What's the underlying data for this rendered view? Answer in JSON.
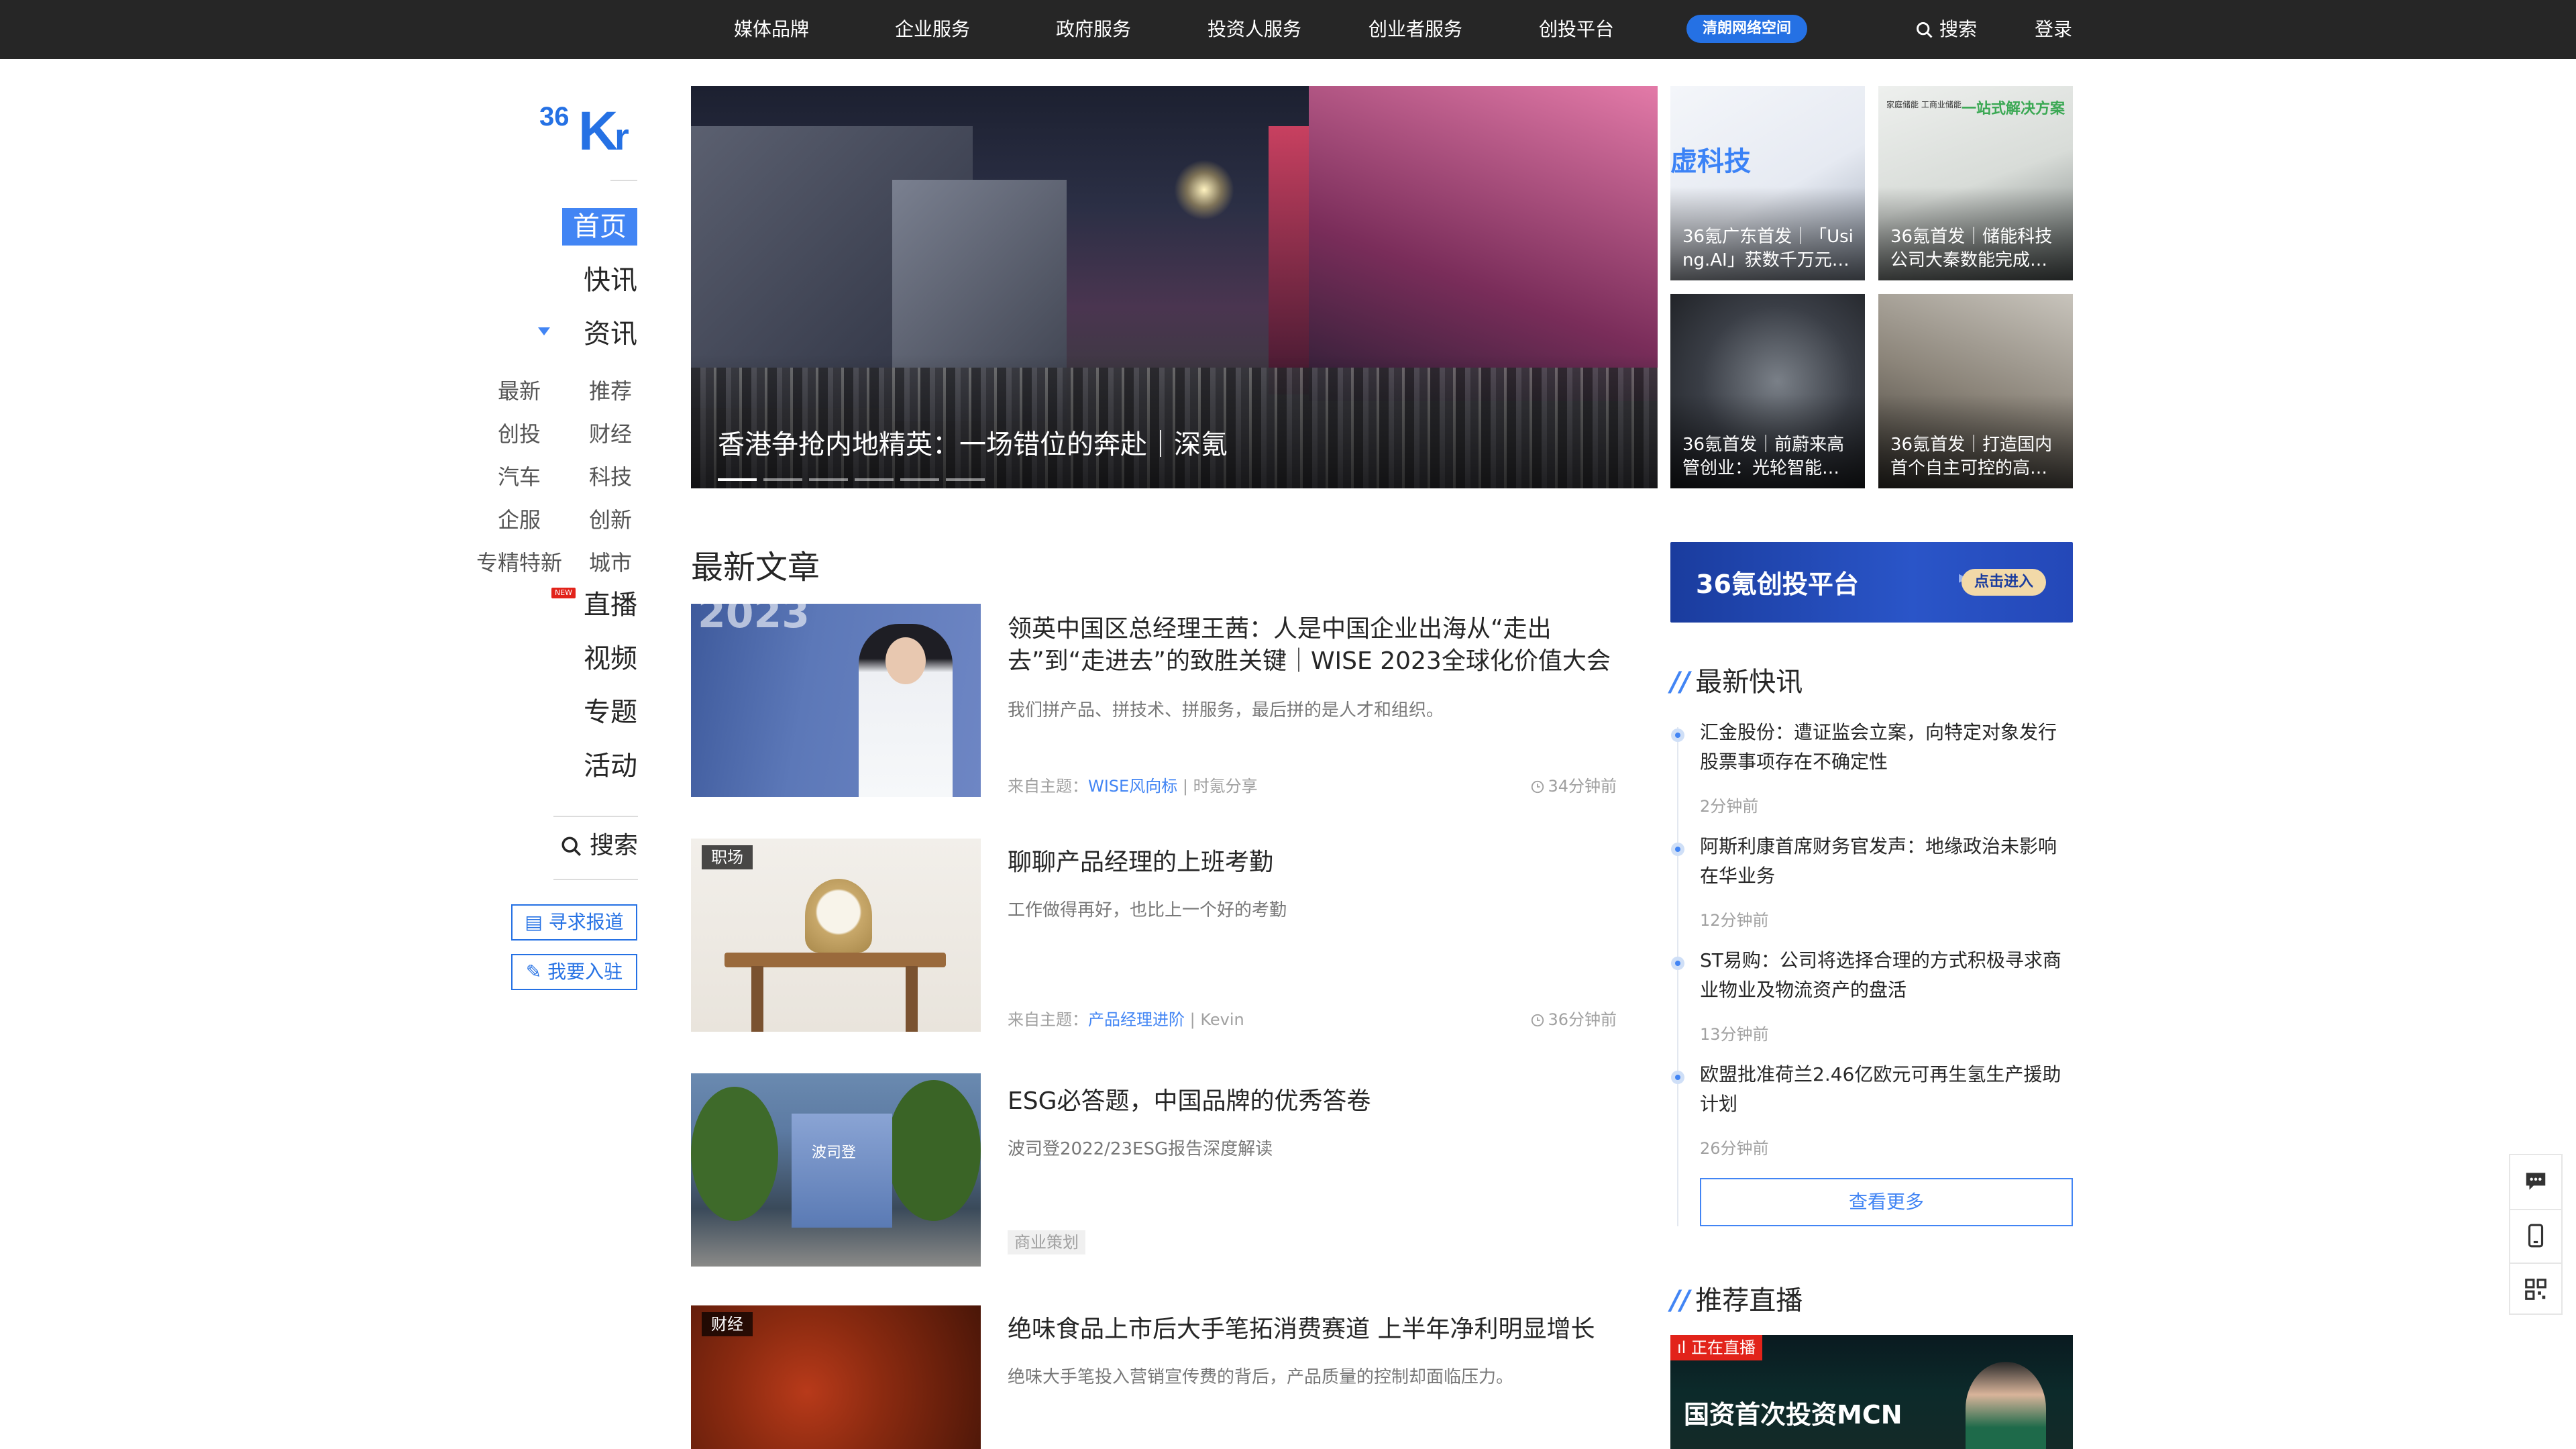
{
  "topnav": {
    "items": [
      "媒体品牌",
      "企业服务",
      "政府服务",
      "投资人服务",
      "创业者服务",
      "创投平台"
    ],
    "badge": "清朗网络空间",
    "search_label": "搜索",
    "login_label": "登录"
  },
  "logo": "36Kr",
  "sidebar": {
    "main": [
      "首页",
      "快讯",
      "资讯",
      "直播",
      "视频",
      "专题",
      "活动"
    ],
    "sub": [
      [
        "最新",
        "推荐"
      ],
      [
        "创投",
        "财经"
      ],
      [
        "汽车",
        "科技"
      ],
      [
        "企服",
        "创新"
      ],
      [
        "专精特新",
        "城市"
      ]
    ],
    "new_tag": "NEW",
    "search_label": "搜索",
    "report_btn": "寻求报道",
    "join_btn": "我要入驻"
  },
  "hero": {
    "title": "香港争抢内地精英：一场错位的奔赴｜深氪",
    "dots": 6,
    "active_dot": 0
  },
  "thumbs": [
    {
      "line1": "36氪广东首发｜「Usi",
      "line2": "ng.AI」获数千万元…",
      "text": "虚科技"
    },
    {
      "line1": "36氪首发｜储能科技",
      "line2": "公司大秦数能完成…",
      "text": "一站式解决方案",
      "small": "家庭储能 工商业储能"
    },
    {
      "line1": "36氪首发｜前蔚来高",
      "line2": "管创业：光轮智能…"
    },
    {
      "line1": "36氪首发｜打造国内",
      "line2": "首个自主可控的高…"
    }
  ],
  "articles": {
    "section_title": "最新文章",
    "items": [
      {
        "title": "领英中国区总经理王茜：人是中国企业出海从“走出去”到“走进去”的致胜关键｜WISE 2023全球化价值大会",
        "desc": "我们拼产品、拼技术、拼服务，最后拼的是人才和组织。",
        "source_prefix": "来自主题：",
        "topic": "WISE风向标",
        "author": "时氪分享",
        "time": "34分钟前",
        "tag": "",
        "year_text": "2023"
      },
      {
        "title": "聊聊产品经理的上班考勤",
        "desc": "工作做得再好，也比上一个好的考勤",
        "source_prefix": "来自主题：",
        "topic": "产品经理进阶",
        "author": "Kevin",
        "time": "36分钟前",
        "tag": "职场"
      },
      {
        "title": "ESG必答题，中国品牌的优秀答卷",
        "desc": "波司登2022/23ESG报告深度解读",
        "chip": "商业策划",
        "tag": "",
        "sign": "波司登"
      },
      {
        "title": "绝味食品上市后大手笔拓消费赛道 上半年净利明显增长",
        "desc": "绝味大手笔投入营销宣传费的背后，产品质量的控制却面临压力。",
        "tag": "财经"
      }
    ]
  },
  "banner": {
    "text": "36氪创投平台",
    "arrows": "▸▸",
    "button": "点击进入"
  },
  "flash": {
    "title": "最新快讯",
    "items": [
      {
        "text": "汇金股份：遭证监会立案，向特定对象发行股票事项存在不确定性",
        "time": "2分钟前"
      },
      {
        "text": "阿斯利康首席财务官发声：地缘政治未影响在华业务",
        "time": "12分钟前"
      },
      {
        "text": "ST易购：公司将选择合理的方式积极寻求商业物业及物流资产的盘活",
        "time": "13分钟前"
      },
      {
        "text": "欧盟批准荷兰2.46亿欧元可再生氢生产援助计划",
        "time": "26分钟前"
      }
    ],
    "more": "查看更多"
  },
  "live": {
    "title": "推荐直播",
    "badge": "正在直播",
    "text": "国资首次投资MCN"
  },
  "colors": {
    "accent": "#4285f4",
    "brand": "#2571e4",
    "topbar": "#262626"
  }
}
